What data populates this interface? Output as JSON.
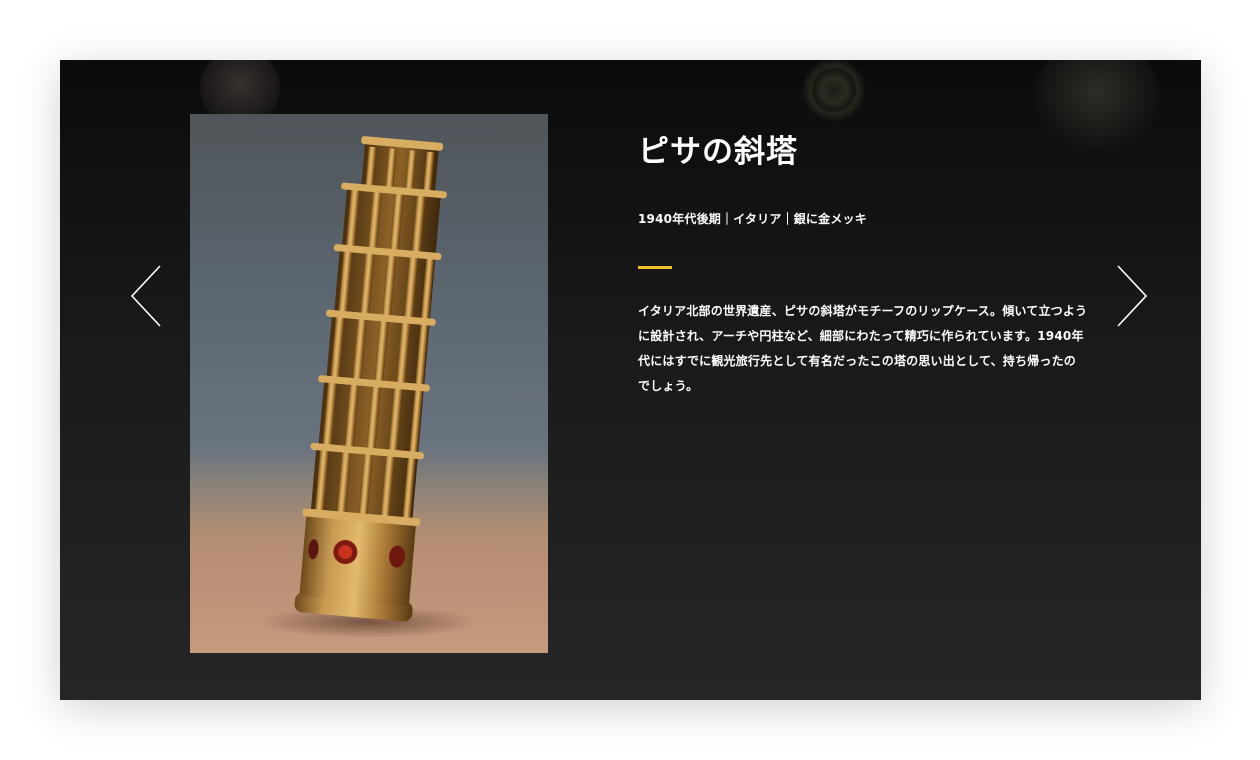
{
  "slide": {
    "title": "ピサの斜塔",
    "meta": "1940年代後期｜イタリア｜銀に金メッキ",
    "description": "イタリア北部の世界遺産、ピサの斜塔がモチーフのリップケース。傾いて立つように設計され、アーチや円柱など、細部にわたって精巧に作られています。1940年代にはすでに観光旅行先として有名だったこの塔の思い出として、持ち帰ったのでしょう。",
    "accent_color": "#f2c12e"
  },
  "navigation": {
    "prev_icon": "chevron-left-icon",
    "next_icon": "chevron-right-icon"
  }
}
